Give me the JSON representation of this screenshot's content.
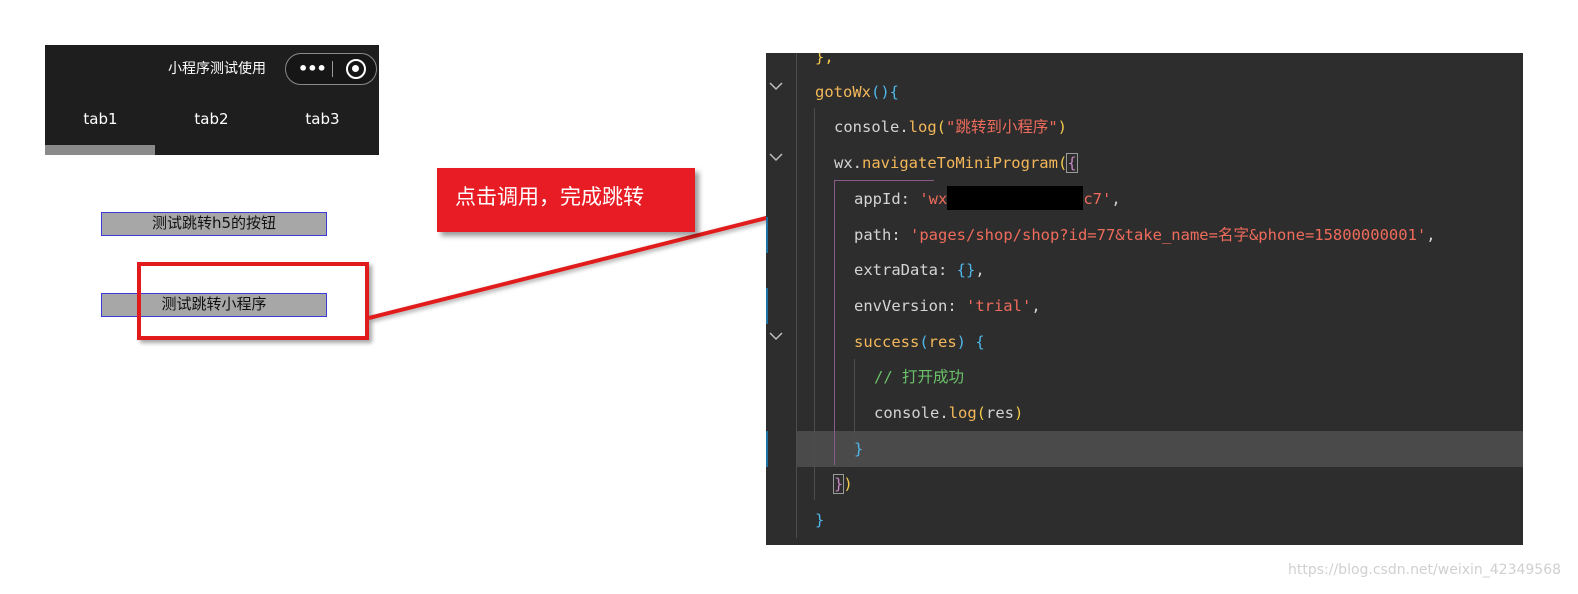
{
  "phone": {
    "title": "小程序测试使用",
    "menu_glyph": "•••",
    "tabs": [
      "tab1",
      "tab2",
      "tab3"
    ],
    "active_tab": "tab1"
  },
  "buttons": {
    "h5": "测试跳转h5的按钮",
    "miniprogram": "测试跳转小程序"
  },
  "callout": "点击调用，完成跳转",
  "code": {
    "l0": "},",
    "l1_name": "gotoWx",
    "l1_rest": "(){",
    "l2_obj": "console.",
    "l2_fn": "log",
    "l2_str": "\"跳转到小程序\"",
    "l3_obj": "wx.",
    "l3_fn": "navigateToMiniProgram",
    "l4_key": "appId: ",
    "l4_pre": "'wx",
    "l4_post": "c7'",
    "l5_key": "path: ",
    "l5_str": "'pages/shop/shop?id=77&take_name=名字&phone=15800000001'",
    "l6_key": "extraData: ",
    "l6_val": "{}",
    "l7_key": "envVersion: ",
    "l7_str": "'trial'",
    "l8_fn": "success",
    "l8_arg": "res",
    "l9_cmt": "// 打开成功",
    "l10_obj": "console.",
    "l10_fn": "log",
    "l10_arg": "res",
    "l11": "}",
    "l12_a": "}",
    "l12_b": ")",
    "l13": "}"
  },
  "watermark": "https://blog.csdn.net/weixin_42349568",
  "colors": {
    "callout_bg": "#e81c24",
    "highlight_border": "#e11b1b",
    "button_border": "#3b3bd6",
    "editor_bg": "#2d2d2d"
  }
}
